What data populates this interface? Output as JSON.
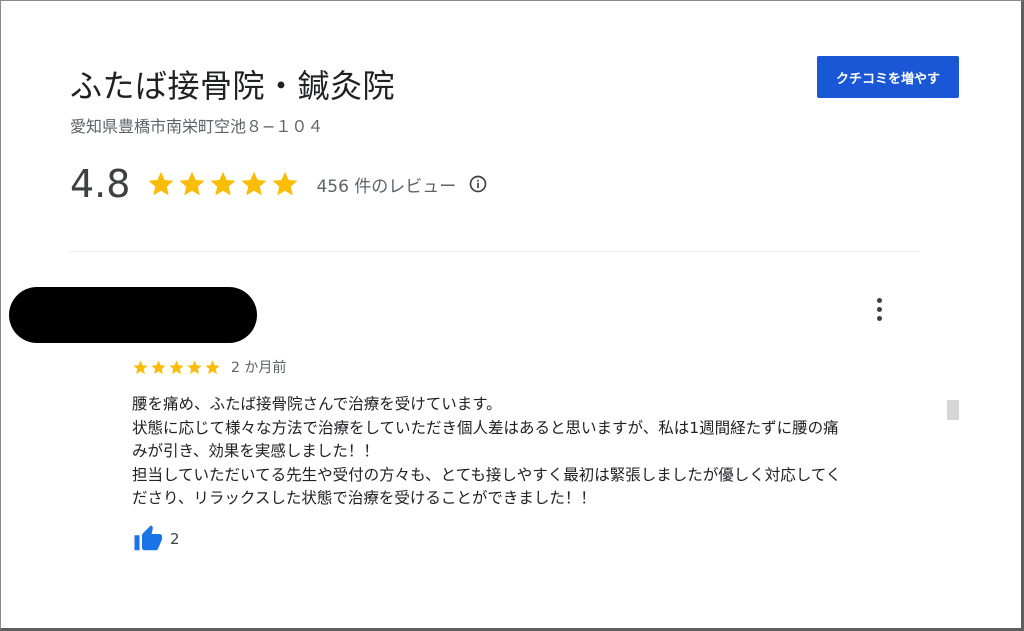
{
  "place": {
    "name": "ふたば接骨院・鍼灸院",
    "address": "愛知県豊橋市南栄町空池８−１０４",
    "rating": "4.8",
    "stars": 5,
    "review_count": "456 件のレビュー"
  },
  "actions": {
    "get_more_reviews_label": "クチコミを増やす"
  },
  "icons": {
    "star": "star-icon",
    "info": "info-icon",
    "more": "more-vert-icon",
    "like": "thumb-up-icon"
  },
  "colors": {
    "star": "#fbbc04",
    "accent": "#1a57d6",
    "like": "#1a73e8"
  },
  "review": {
    "stars": 5,
    "time": "2 か月前",
    "lines": [
      "腰を痛め、ふたば接骨院さんで治療を受けています。",
      "状態に応じて様々な方法で治療をしていただき個人差はあると思いますが、私は1週間経たずに腰の痛",
      "みが引き、効果を実感しました！！",
      "担当していただいてる先生や受付の方々も、とても接しやすく最初は緊張しましたが優しく対応してく",
      "ださり、リラックスした状態で治療を受けることができました！！"
    ],
    "like_count": "2"
  }
}
